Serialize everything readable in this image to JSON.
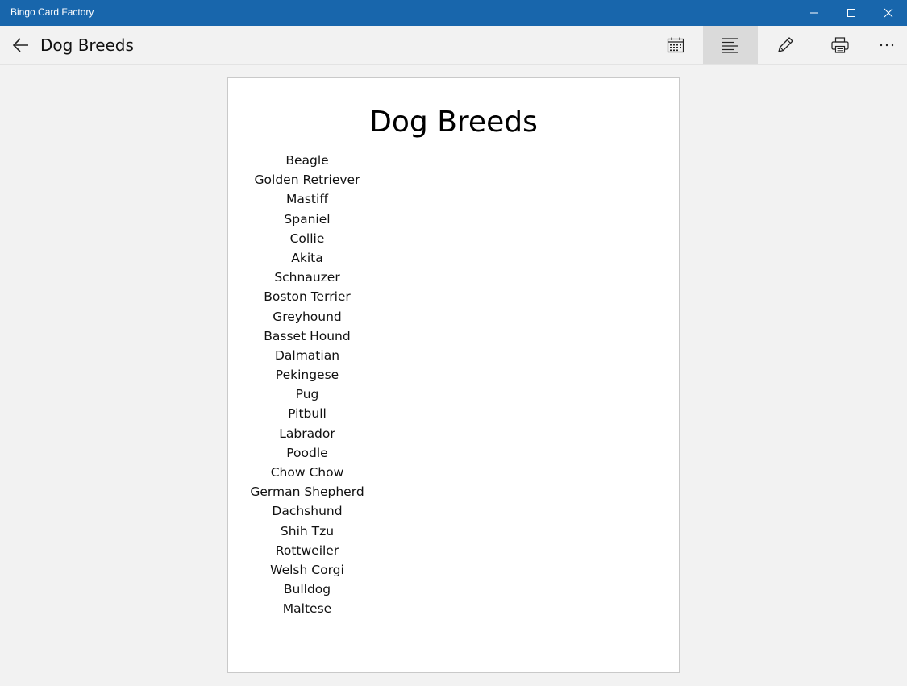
{
  "window": {
    "app_title": "Bingo Card Factory"
  },
  "header": {
    "title": "Dog Breeds"
  },
  "toolbar": {
    "icons": [
      "calendar-icon",
      "align-text-icon",
      "pencil-icon",
      "printer-icon",
      "more-icon"
    ],
    "active": "align-text-icon"
  },
  "document": {
    "title": "Dog Breeds",
    "items": [
      "Beagle",
      "Golden Retriever",
      "Mastiff",
      "Spaniel",
      "Collie",
      "Akita",
      "Schnauzer",
      "Boston Terrier",
      "Greyhound",
      "Basset Hound",
      "Dalmatian",
      "Pekingese",
      "Pug",
      "Pitbull",
      "Labrador",
      "Poodle",
      "Chow Chow",
      "German Shepherd",
      "Dachshund",
      "Shih Tzu",
      "Rottweiler",
      "Welsh Corgi",
      "Bulldog",
      "Maltese"
    ]
  },
  "colors": {
    "titlebar": "#1866ac",
    "background": "#f2f2f2",
    "active_tool": "#dadada"
  }
}
